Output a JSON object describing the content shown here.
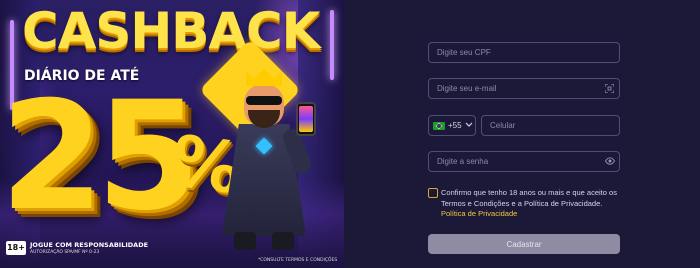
{
  "banner": {
    "title": "CASHBACK",
    "subtitle": "DIÁRIO DE ATÉ",
    "big_number": "25",
    "percent": "%",
    "age_badge": "18+",
    "footer_line1": "JOGUE COM RESPONSABILIDADE",
    "footer_line2": "AUTORIZAÇÃO SPA/MF Nº 0-23",
    "terms_note": "*CONSULTE TERMOS E CONDIÇÕES"
  },
  "form": {
    "cpf_placeholder": "Digite seu CPF",
    "email_placeholder": "Digite seu e-mail",
    "phone_code": "+55",
    "phone_placeholder": "Celular",
    "password_placeholder": "Digite a senha",
    "terms_text": "Confirmo que tenho 18 anos ou mais e que aceito os Termos e Condições e a Política de Privacidade.",
    "privacy_link": "Política de Privacidade",
    "submit_label": "Cadastrar",
    "icons": {
      "email": "scan-icon",
      "password": "eye-icon",
      "country": "brazil-flag-icon",
      "dropdown": "chevron-down-icon"
    },
    "colors": {
      "background": "#1c1838",
      "border": "#524c78",
      "accent": "#f2c93c",
      "submit_bg": "#8e8ba3"
    }
  }
}
